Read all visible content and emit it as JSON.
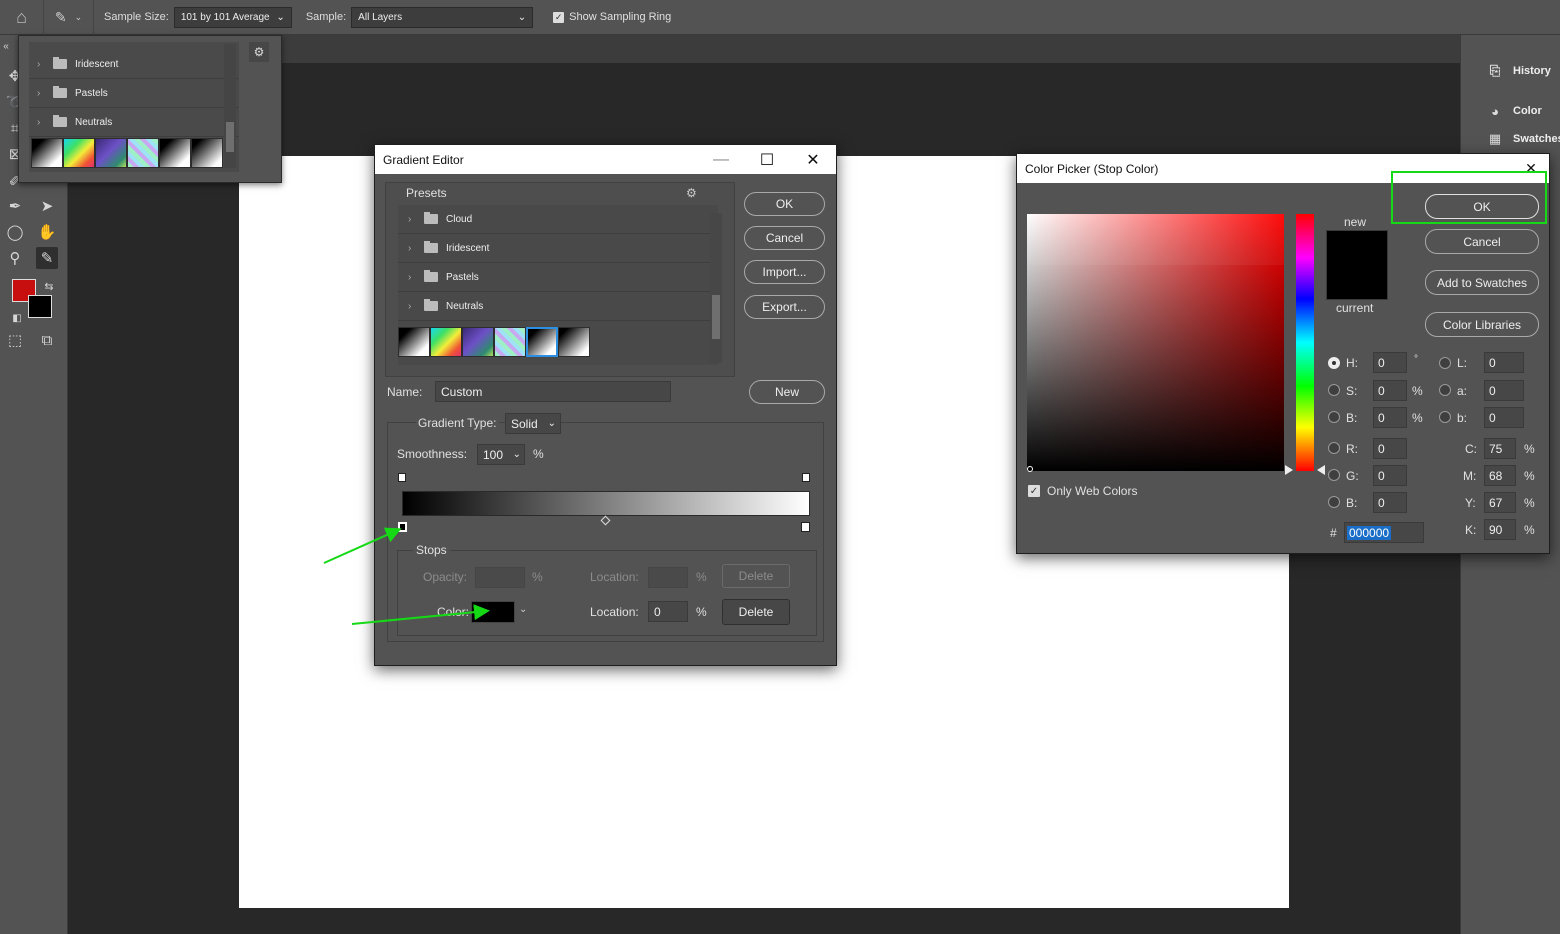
{
  "optionsbar": {
    "sample_size_label": "Sample Size:",
    "sample_size_value": "101 by 101 Average",
    "sample_label": "Sample:",
    "sample_value": "All Layers",
    "show_sampling_ring": "Show Sampling Ring"
  },
  "right_dock": {
    "history": "History",
    "color": "Color",
    "swatches": "Swatches"
  },
  "preset_popup": {
    "items": [
      "Iridescent",
      "Pastels",
      "Neutrals"
    ]
  },
  "gradient_editor": {
    "title": "Gradient Editor",
    "presets_label": "Presets",
    "preset_folders": [
      "Cloud",
      "Iridescent",
      "Pastels",
      "Neutrals"
    ],
    "ok": "OK",
    "cancel": "Cancel",
    "import": "Import...",
    "export": "Export...",
    "name_label": "Name:",
    "name_value": "Custom",
    "new": "New",
    "gradient_type_label": "Gradient Type:",
    "gradient_type_value": "Solid",
    "smoothness_label": "Smoothness:",
    "smoothness_value": "100",
    "percent": "%",
    "stops_label": "Stops",
    "opacity_label": "Opacity:",
    "location_label": "Location:",
    "delete": "Delete",
    "color_label": "Color:",
    "location_value": "0"
  },
  "color_picker": {
    "title": "Color Picker (Stop Color)",
    "ok": "OK",
    "cancel": "Cancel",
    "add_to_swatches": "Add to Swatches",
    "color_libraries": "Color Libraries",
    "new_label": "new",
    "current_label": "current",
    "only_web_colors": "Only Web Colors",
    "H": "0",
    "S": "0",
    "B": "0",
    "R": "0",
    "G": "0",
    "B2": "0",
    "L": "0",
    "a": "0",
    "b": "0",
    "C": "75",
    "M": "68",
    "Y": "67",
    "K": "90",
    "hex": "000000",
    "labels": {
      "H": "H:",
      "S": "S:",
      "B": "B:",
      "R": "R:",
      "G": "G:",
      "L": "L:",
      "a": "a:",
      "b": "b:",
      "C": "C:",
      "M": "M:",
      "Y": "Y:",
      "K": "K:",
      "hash": "#",
      "deg": "°",
      "pct": "%"
    }
  },
  "colors": {
    "foreground": "#c80f0f",
    "background": "#000000",
    "highlight": "#16d916"
  }
}
